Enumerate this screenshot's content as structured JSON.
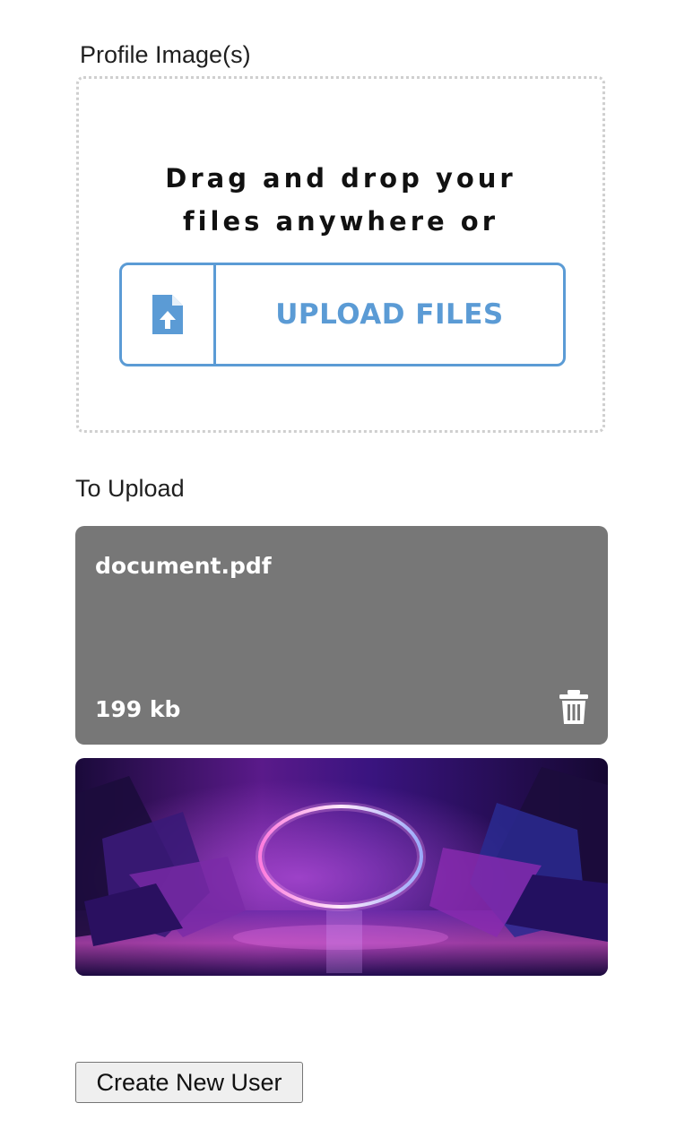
{
  "profile_images": {
    "label": "Profile Image(s)",
    "dropzone": {
      "line1": "Drag and drop your",
      "line2": "files anywhere or",
      "upload_button_label": "UPLOAD FILES",
      "icon": "file-upload-icon"
    }
  },
  "to_upload": {
    "label": "To Upload",
    "files": [
      {
        "name": "document.pdf",
        "size": "199 kb",
        "delete_icon": "trash-icon"
      }
    ],
    "image_preview": {
      "description_icon": "image-preview"
    }
  },
  "form": {
    "submit_label": "Create New User"
  },
  "colors": {
    "accent": "#5b9bd5",
    "file_card_bg": "#777777",
    "dropzone_border": "#cfcfcf"
  }
}
